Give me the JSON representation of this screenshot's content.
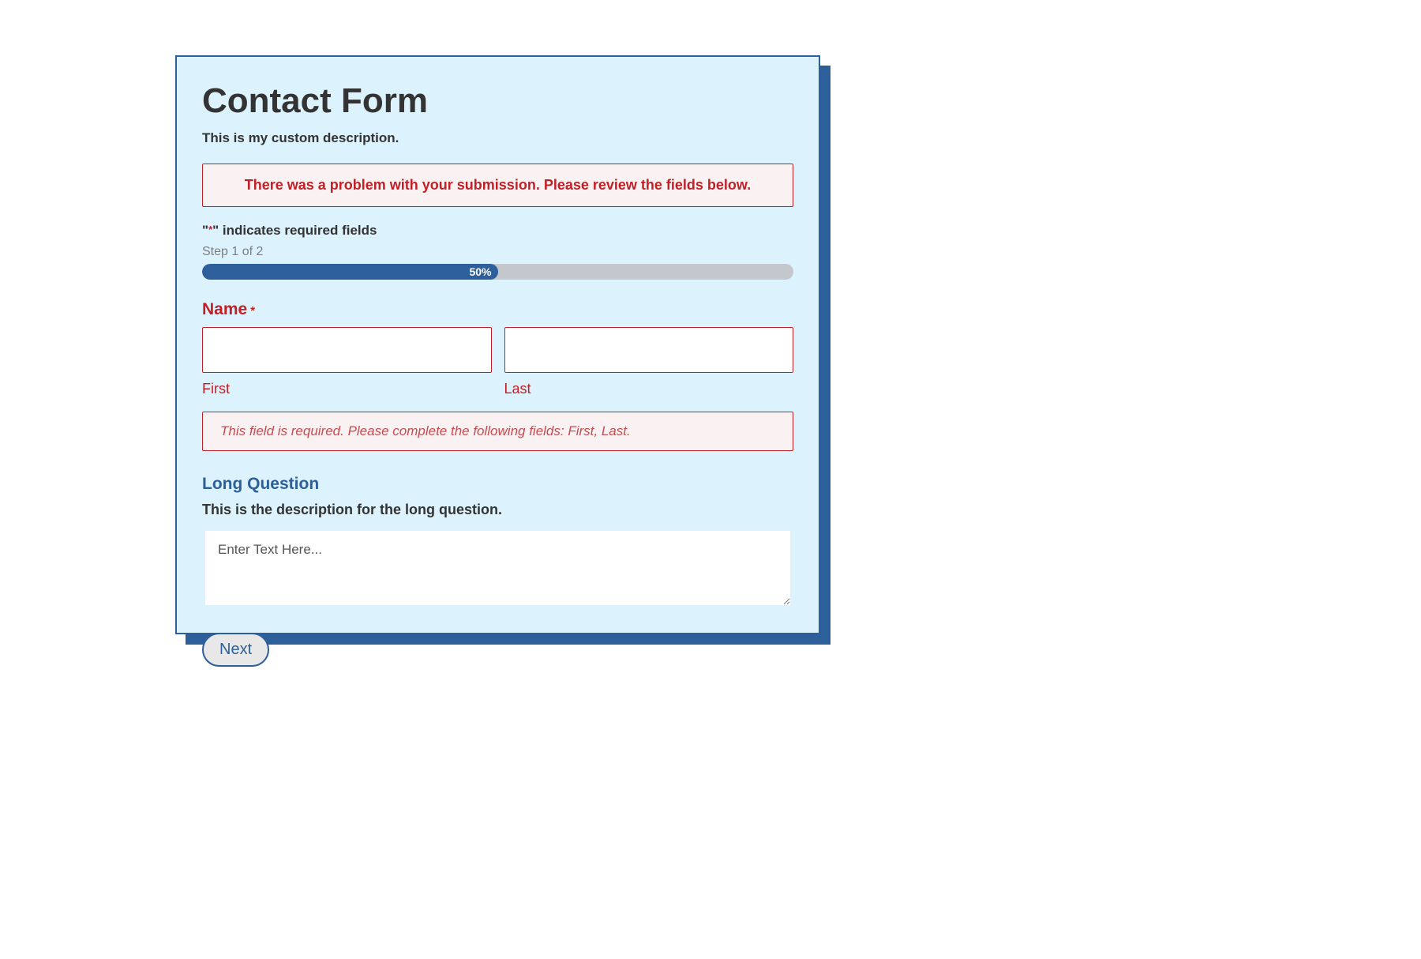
{
  "form": {
    "title": "Contact Form",
    "description": "This is my custom description.",
    "error_banner": "There was a problem with your submission. Please review the fields below.",
    "required_note_prefix": "\"",
    "required_note_asterisk": "*",
    "required_note_suffix": "\" indicates required fields",
    "step_label": "Step 1 of 2",
    "progress_percent_label": "50%",
    "progress_percent_value": 50
  },
  "name_field": {
    "label": "Name",
    "required_marker": "*",
    "first_sub": "First",
    "last_sub": "Last",
    "first_value": "",
    "last_value": "",
    "error_message": "This field is required. Please complete the following fields: First, Last."
  },
  "long_question": {
    "label": "Long Question",
    "description": "This is the description for the long question.",
    "placeholder": "Enter Text Here...",
    "value": ""
  },
  "buttons": {
    "next": "Next"
  }
}
